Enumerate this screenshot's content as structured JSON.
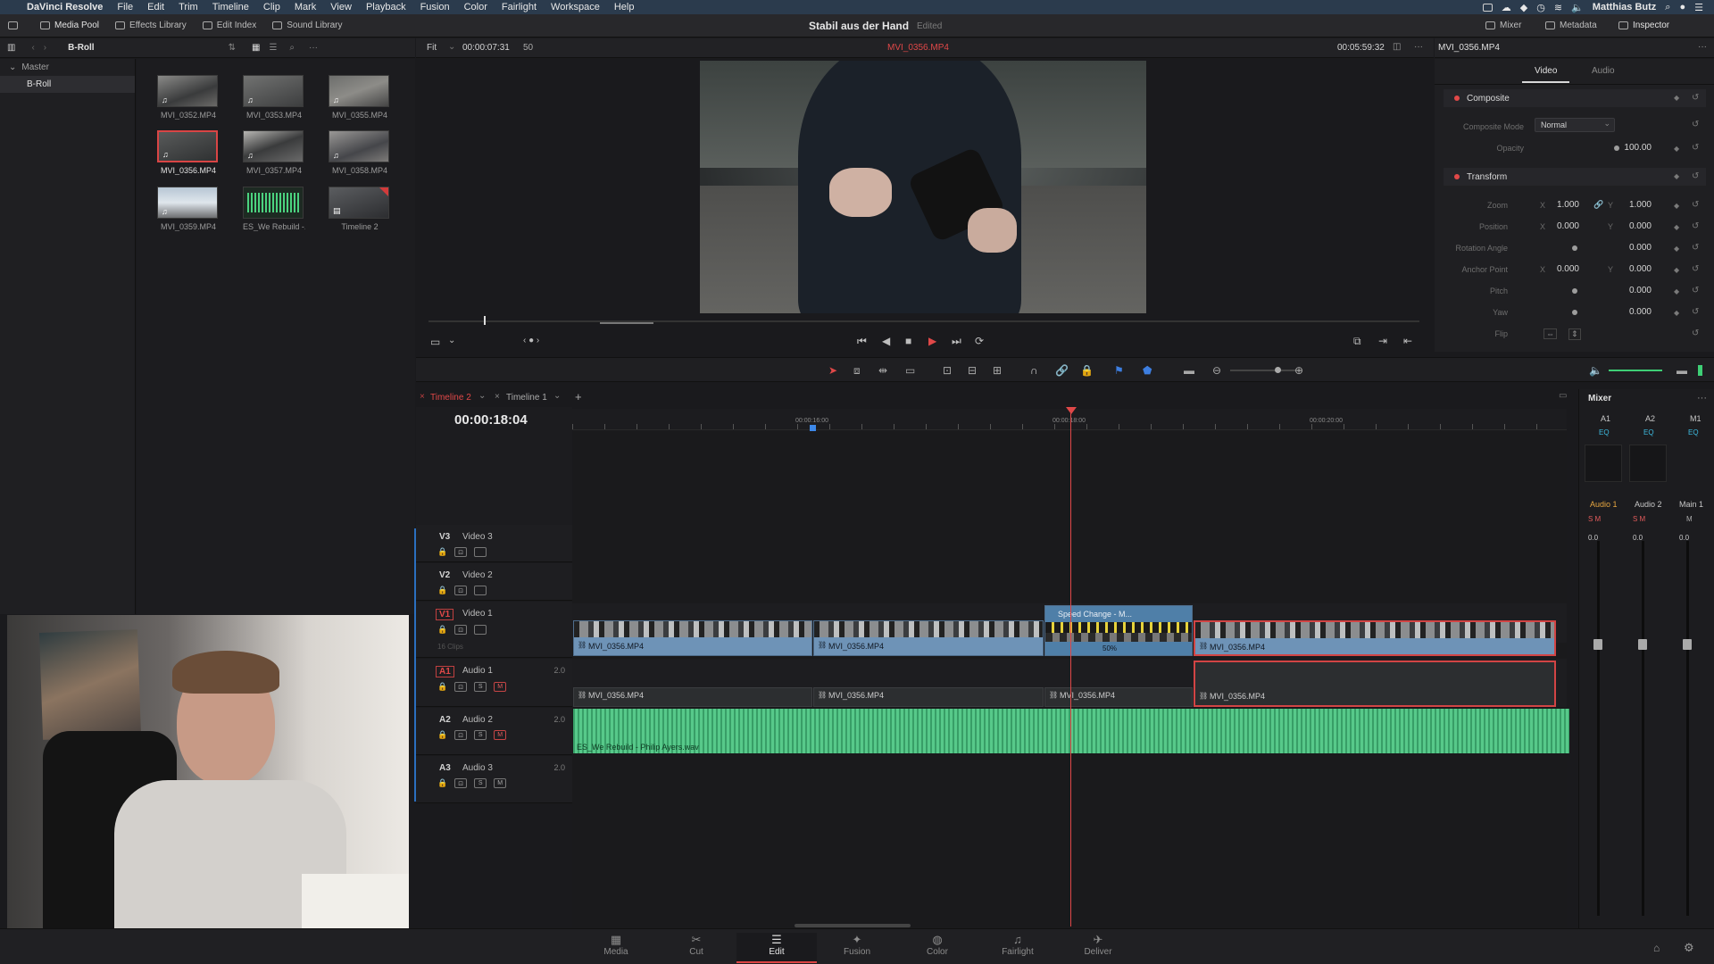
{
  "menubar": {
    "app": "DaVinci Resolve",
    "items": [
      "File",
      "Edit",
      "Trim",
      "Timeline",
      "Clip",
      "Mark",
      "View",
      "Playback",
      "Fusion",
      "Color",
      "Fairlight",
      "Workspace",
      "Help"
    ],
    "user": "Matthias Butz"
  },
  "toolbar": {
    "media_pool": "Media Pool",
    "effects_library": "Effects Library",
    "edit_index": "Edit Index",
    "sound_library": "Sound Library",
    "project_title": "Stabil aus der Hand",
    "project_status": "Edited",
    "mixer": "Mixer",
    "metadata": "Metadata",
    "inspector": "Inspector"
  },
  "media_pool": {
    "bin_name": "B-Roll",
    "bins": [
      "Master",
      "B-Roll"
    ],
    "clips": [
      {
        "name": "MVI_0352.MP4",
        "type": "video"
      },
      {
        "name": "MVI_0353.MP4",
        "type": "video"
      },
      {
        "name": "MVI_0355.MP4",
        "type": "video"
      },
      {
        "name": "MVI_0356.MP4",
        "type": "video",
        "selected": true
      },
      {
        "name": "MVI_0357.MP4",
        "type": "video"
      },
      {
        "name": "MVI_0358.MP4",
        "type": "video"
      },
      {
        "name": "MVI_0359.MP4",
        "type": "video"
      },
      {
        "name": "ES_We Rebuild -...",
        "type": "audio"
      },
      {
        "name": "Timeline 2",
        "type": "timeline"
      }
    ]
  },
  "viewer": {
    "zoom": "Fit",
    "source_timecode": "00:00:07:31",
    "frame_rate": "50",
    "clip_name": "MVI_0356.MP4",
    "duration": "00:05:59:32"
  },
  "inspector": {
    "clip_name": "MVI_0356.MP4",
    "tabs": [
      "Video",
      "Audio"
    ],
    "composite": {
      "title": "Composite",
      "mode_label": "Composite Mode",
      "mode_value": "Normal",
      "opacity_label": "Opacity",
      "opacity_value": "100.00"
    },
    "transform": {
      "title": "Transform",
      "zoom_label": "Zoom",
      "zoom_x": "1.000",
      "zoom_y": "1.000",
      "position_label": "Position",
      "position_x": "0.000",
      "position_y": "0.000",
      "rotation_label": "Rotation Angle",
      "rotation_value": "0.000",
      "anchor_label": "Anchor Point",
      "anchor_x": "0.000",
      "anchor_y": "0.000",
      "pitch_label": "Pitch",
      "pitch_value": "0.000",
      "yaw_label": "Yaw",
      "yaw_value": "0.000",
      "flip_label": "Flip"
    }
  },
  "timeline": {
    "tabs": [
      "Timeline 2",
      "Timeline 1"
    ],
    "timecode": "00:00:18:04",
    "ruler": [
      "00:00:16:00",
      "00:00:18:00",
      "00:00:20:00"
    ],
    "clip_count": "16 Clips",
    "tracks": {
      "v3": {
        "id": "V3",
        "name": "Video 3"
      },
      "v2": {
        "id": "V2",
        "name": "Video 2"
      },
      "v1": {
        "id": "V1",
        "name": "Video 1"
      },
      "a1": {
        "id": "A1",
        "name": "Audio 1",
        "ch": "2.0"
      },
      "a2": {
        "id": "A2",
        "name": "Audio 2",
        "ch": "2.0"
      },
      "a3": {
        "id": "A3",
        "name": "Audio 3",
        "ch": "2.0"
      }
    },
    "video_clips": [
      "MVI_0356.MP4",
      "MVI_0356.MP4",
      "MVI_0356.MP4"
    ],
    "speed_change": "Speed Change - M...",
    "speed_percent": "50%",
    "audio_clips": [
      "MVI_0356.MP4",
      "MVI_0356.MP4",
      "MVI_0356.MP4",
      "MVI_0356.MP4"
    ],
    "music": "ES_We Rebuild - Philip Ayers.wav"
  },
  "mixer": {
    "title": "Mixer",
    "channels": [
      "A1",
      "A2",
      "M1"
    ],
    "strips": [
      "Audio 1",
      "Audio 2",
      "Main 1"
    ],
    "values": [
      "0.0",
      "0.0",
      "0.0"
    ],
    "eq": "EQ"
  },
  "pages": [
    "Media",
    "Cut",
    "Edit",
    "Fusion",
    "Color",
    "Fairlight",
    "Deliver"
  ]
}
